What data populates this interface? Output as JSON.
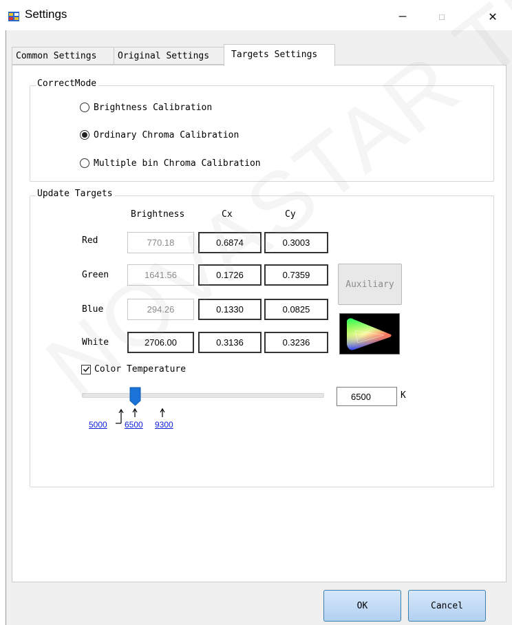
{
  "window": {
    "title": "Settings",
    "minimize_glyph": "—",
    "maximize_glyph": "☐",
    "close_glyph": "✕"
  },
  "tabs": [
    {
      "label": "Common Settings",
      "selected": false
    },
    {
      "label": "Original Settings",
      "selected": false
    },
    {
      "label": "Targets Settings",
      "selected": true
    }
  ],
  "correct_mode": {
    "title": "CorrectMode",
    "options": [
      {
        "label": "Brightness Calibration",
        "selected": false
      },
      {
        "label": "Ordinary Chroma Calibration",
        "selected": true
      },
      {
        "label": "Multiple bin Chroma Calibration",
        "selected": false
      }
    ]
  },
  "update_targets": {
    "title": "Update Targets",
    "columns": [
      "Brightness",
      "Cx",
      "Cy"
    ],
    "rows": [
      {
        "label": "Red",
        "brightness": "770.18",
        "cx": "0.6874",
        "cy": "0.3003"
      },
      {
        "label": "Green",
        "brightness": "1641.56",
        "cx": "0.1726",
        "cy": "0.7359"
      },
      {
        "label": "Blue",
        "brightness": "294.26",
        "cx": "0.1330",
        "cy": "0.0825"
      },
      {
        "label": "White",
        "brightness": "2706.00",
        "cx": "0.3136",
        "cy": "0.3236"
      }
    ],
    "auxiliary_label": "Auxiliary",
    "color_temperature": {
      "label": "Color Temperature",
      "checked": true,
      "value": "6500",
      "unit": "K",
      "presets": [
        "5000",
        "6500",
        "9300"
      ]
    }
  },
  "footer": {
    "ok_label": "OK",
    "cancel_label": "Cancel"
  },
  "watermark": "NOVASTAR TECH",
  "colors": {
    "accent_blue": "#1a73d9",
    "link_blue": "#0a1ee0",
    "button_border": "#3c7fb1"
  },
  "icons": {
    "app": "settings-app-icon",
    "slider_thumb": "slider-thumb",
    "gamut": "cie-color-gamut-icon"
  }
}
